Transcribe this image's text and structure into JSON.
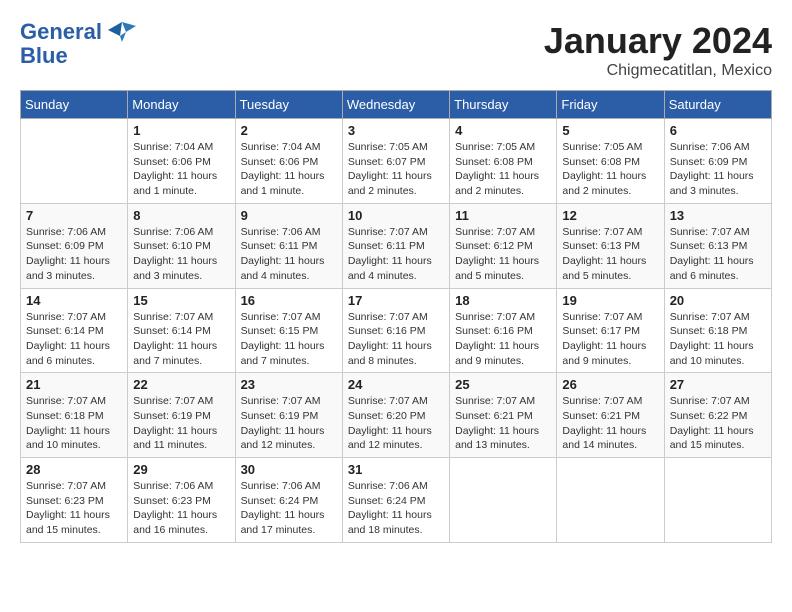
{
  "header": {
    "logo_line1": "General",
    "logo_line2": "Blue",
    "title": "January 2024",
    "subtitle": "Chigmecatitlan, Mexico"
  },
  "weekdays": [
    "Sunday",
    "Monday",
    "Tuesday",
    "Wednesday",
    "Thursday",
    "Friday",
    "Saturday"
  ],
  "weeks": [
    [
      {
        "day": "",
        "sunrise": "",
        "sunset": "",
        "daylight": ""
      },
      {
        "day": "1",
        "sunrise": "Sunrise: 7:04 AM",
        "sunset": "Sunset: 6:06 PM",
        "daylight": "Daylight: 11 hours and 1 minute."
      },
      {
        "day": "2",
        "sunrise": "Sunrise: 7:04 AM",
        "sunset": "Sunset: 6:06 PM",
        "daylight": "Daylight: 11 hours and 1 minute."
      },
      {
        "day": "3",
        "sunrise": "Sunrise: 7:05 AM",
        "sunset": "Sunset: 6:07 PM",
        "daylight": "Daylight: 11 hours and 2 minutes."
      },
      {
        "day": "4",
        "sunrise": "Sunrise: 7:05 AM",
        "sunset": "Sunset: 6:08 PM",
        "daylight": "Daylight: 11 hours and 2 minutes."
      },
      {
        "day": "5",
        "sunrise": "Sunrise: 7:05 AM",
        "sunset": "Sunset: 6:08 PM",
        "daylight": "Daylight: 11 hours and 2 minutes."
      },
      {
        "day": "6",
        "sunrise": "Sunrise: 7:06 AM",
        "sunset": "Sunset: 6:09 PM",
        "daylight": "Daylight: 11 hours and 3 minutes."
      }
    ],
    [
      {
        "day": "7",
        "sunrise": "Sunrise: 7:06 AM",
        "sunset": "Sunset: 6:09 PM",
        "daylight": "Daylight: 11 hours and 3 minutes."
      },
      {
        "day": "8",
        "sunrise": "Sunrise: 7:06 AM",
        "sunset": "Sunset: 6:10 PM",
        "daylight": "Daylight: 11 hours and 3 minutes."
      },
      {
        "day": "9",
        "sunrise": "Sunrise: 7:06 AM",
        "sunset": "Sunset: 6:11 PM",
        "daylight": "Daylight: 11 hours and 4 minutes."
      },
      {
        "day": "10",
        "sunrise": "Sunrise: 7:07 AM",
        "sunset": "Sunset: 6:11 PM",
        "daylight": "Daylight: 11 hours and 4 minutes."
      },
      {
        "day": "11",
        "sunrise": "Sunrise: 7:07 AM",
        "sunset": "Sunset: 6:12 PM",
        "daylight": "Daylight: 11 hours and 5 minutes."
      },
      {
        "day": "12",
        "sunrise": "Sunrise: 7:07 AM",
        "sunset": "Sunset: 6:13 PM",
        "daylight": "Daylight: 11 hours and 5 minutes."
      },
      {
        "day": "13",
        "sunrise": "Sunrise: 7:07 AM",
        "sunset": "Sunset: 6:13 PM",
        "daylight": "Daylight: 11 hours and 6 minutes."
      }
    ],
    [
      {
        "day": "14",
        "sunrise": "Sunrise: 7:07 AM",
        "sunset": "Sunset: 6:14 PM",
        "daylight": "Daylight: 11 hours and 6 minutes."
      },
      {
        "day": "15",
        "sunrise": "Sunrise: 7:07 AM",
        "sunset": "Sunset: 6:14 PM",
        "daylight": "Daylight: 11 hours and 7 minutes."
      },
      {
        "day": "16",
        "sunrise": "Sunrise: 7:07 AM",
        "sunset": "Sunset: 6:15 PM",
        "daylight": "Daylight: 11 hours and 7 minutes."
      },
      {
        "day": "17",
        "sunrise": "Sunrise: 7:07 AM",
        "sunset": "Sunset: 6:16 PM",
        "daylight": "Daylight: 11 hours and 8 minutes."
      },
      {
        "day": "18",
        "sunrise": "Sunrise: 7:07 AM",
        "sunset": "Sunset: 6:16 PM",
        "daylight": "Daylight: 11 hours and 9 minutes."
      },
      {
        "day": "19",
        "sunrise": "Sunrise: 7:07 AM",
        "sunset": "Sunset: 6:17 PM",
        "daylight": "Daylight: 11 hours and 9 minutes."
      },
      {
        "day": "20",
        "sunrise": "Sunrise: 7:07 AM",
        "sunset": "Sunset: 6:18 PM",
        "daylight": "Daylight: 11 hours and 10 minutes."
      }
    ],
    [
      {
        "day": "21",
        "sunrise": "Sunrise: 7:07 AM",
        "sunset": "Sunset: 6:18 PM",
        "daylight": "Daylight: 11 hours and 10 minutes."
      },
      {
        "day": "22",
        "sunrise": "Sunrise: 7:07 AM",
        "sunset": "Sunset: 6:19 PM",
        "daylight": "Daylight: 11 hours and 11 minutes."
      },
      {
        "day": "23",
        "sunrise": "Sunrise: 7:07 AM",
        "sunset": "Sunset: 6:19 PM",
        "daylight": "Daylight: 11 hours and 12 minutes."
      },
      {
        "day": "24",
        "sunrise": "Sunrise: 7:07 AM",
        "sunset": "Sunset: 6:20 PM",
        "daylight": "Daylight: 11 hours and 12 minutes."
      },
      {
        "day": "25",
        "sunrise": "Sunrise: 7:07 AM",
        "sunset": "Sunset: 6:21 PM",
        "daylight": "Daylight: 11 hours and 13 minutes."
      },
      {
        "day": "26",
        "sunrise": "Sunrise: 7:07 AM",
        "sunset": "Sunset: 6:21 PM",
        "daylight": "Daylight: 11 hours and 14 minutes."
      },
      {
        "day": "27",
        "sunrise": "Sunrise: 7:07 AM",
        "sunset": "Sunset: 6:22 PM",
        "daylight": "Daylight: 11 hours and 15 minutes."
      }
    ],
    [
      {
        "day": "28",
        "sunrise": "Sunrise: 7:07 AM",
        "sunset": "Sunset: 6:23 PM",
        "daylight": "Daylight: 11 hours and 15 minutes."
      },
      {
        "day": "29",
        "sunrise": "Sunrise: 7:06 AM",
        "sunset": "Sunset: 6:23 PM",
        "daylight": "Daylight: 11 hours and 16 minutes."
      },
      {
        "day": "30",
        "sunrise": "Sunrise: 7:06 AM",
        "sunset": "Sunset: 6:24 PM",
        "daylight": "Daylight: 11 hours and 17 minutes."
      },
      {
        "day": "31",
        "sunrise": "Sunrise: 7:06 AM",
        "sunset": "Sunset: 6:24 PM",
        "daylight": "Daylight: 11 hours and 18 minutes."
      },
      {
        "day": "",
        "sunrise": "",
        "sunset": "",
        "daylight": ""
      },
      {
        "day": "",
        "sunrise": "",
        "sunset": "",
        "daylight": ""
      },
      {
        "day": "",
        "sunrise": "",
        "sunset": "",
        "daylight": ""
      }
    ]
  ]
}
